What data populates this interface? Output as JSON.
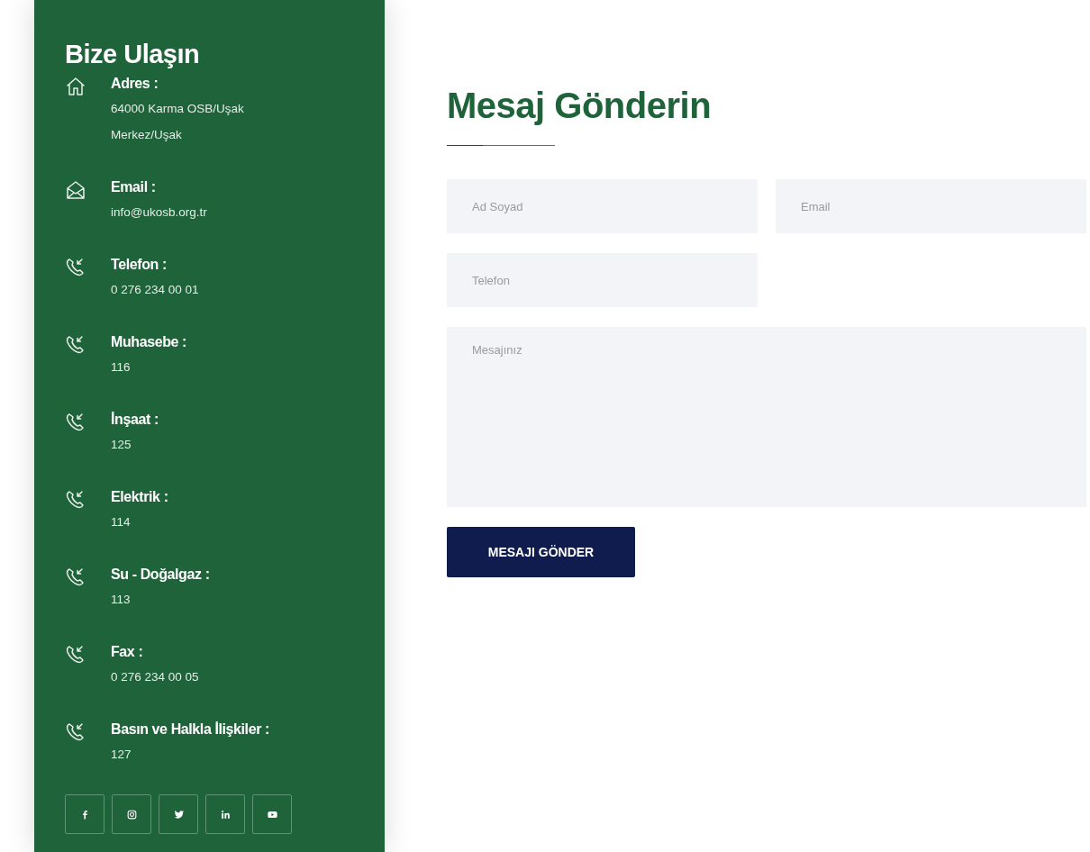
{
  "contact_panel": {
    "title": "Bize Ulaşın",
    "items": [
      {
        "kind": "address",
        "label": "Adres :",
        "lines": [
          "64000 Karma OSB/Uşak",
          "Merkez/Uşak"
        ]
      },
      {
        "kind": "email",
        "label": "Email :",
        "lines": [
          "info@ukosb.org.tr"
        ]
      },
      {
        "kind": "phone",
        "label": "Telefon :",
        "lines": [
          "0 276 234 00 01"
        ]
      },
      {
        "kind": "phone",
        "label": "Muhasebe :",
        "lines": [
          "116"
        ]
      },
      {
        "kind": "phone",
        "label": "İnşaat :",
        "lines": [
          "125"
        ]
      },
      {
        "kind": "phone",
        "label": "Elektrik :",
        "lines": [
          "114"
        ]
      },
      {
        "kind": "phone",
        "label": "Su - Doğalgaz :",
        "lines": [
          "113"
        ]
      },
      {
        "kind": "phone",
        "label": "Fax :",
        "lines": [
          "0 276 234 00 05"
        ]
      },
      {
        "kind": "phone",
        "label": "Basın ve Halkla İlişkiler :",
        "lines": [
          "127"
        ]
      }
    ],
    "social": [
      {
        "kind": "facebook"
      },
      {
        "kind": "instagram"
      },
      {
        "kind": "twitter"
      },
      {
        "kind": "linkedin"
      },
      {
        "kind": "youtube"
      }
    ]
  },
  "form": {
    "title": "Mesaj Gönderin",
    "fields": [
      {
        "kind": "half",
        "placeholder": "Ad Soyad"
      },
      {
        "kind": "half",
        "placeholder": "Email"
      },
      {
        "kind": "half",
        "placeholder": "Telefon"
      },
      {
        "kind": "textarea",
        "placeholder": "Mesajınız"
      }
    ],
    "submit": "MESAJI GÖNDER"
  }
}
